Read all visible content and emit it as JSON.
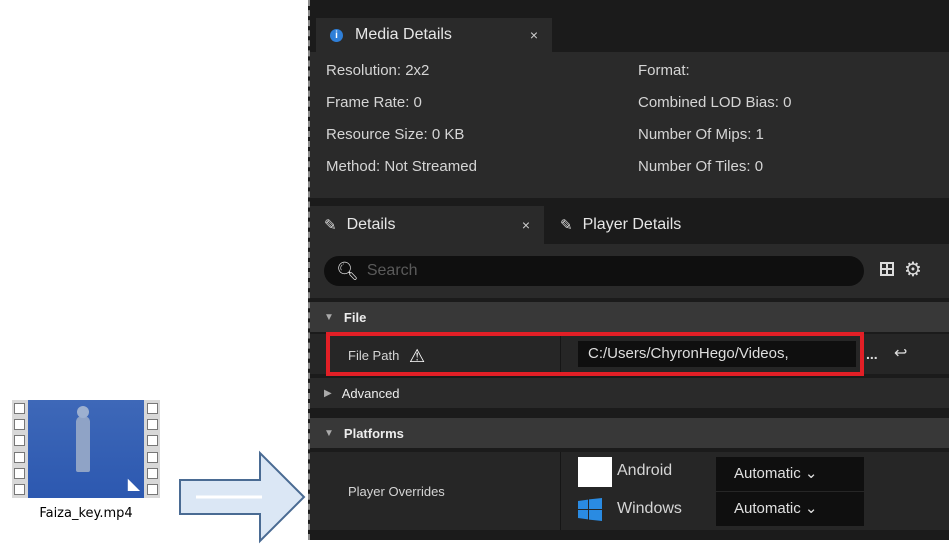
{
  "file_icon": {
    "name": "Faiza_key.mp4"
  },
  "media_details": {
    "tab_label": "Media Details",
    "close_glyph": "×",
    "left": [
      "Resolution: 2x2",
      "Frame Rate: 0",
      "Resource Size: 0 KB",
      "Method: Not Streamed"
    ],
    "right": [
      "Format:",
      "Combined LOD Bias: 0",
      "Number Of Mips: 1",
      "Number Of Tiles: 0"
    ]
  },
  "details": {
    "tabs": [
      {
        "label": "Details",
        "close": "×"
      },
      {
        "label": "Player Details"
      }
    ],
    "search_placeholder": "Search",
    "categories": {
      "file": "File",
      "advanced": "Advanced",
      "platforms": "Platforms"
    },
    "file_path": {
      "label": "File Path",
      "value": "C:/Users/ChyronHego/Videos,",
      "browse": "...",
      "reset_glyph": "↩"
    },
    "player_overrides": {
      "label": "Player Overrides",
      "platforms": [
        {
          "name": "Android",
          "value": "Automatic ⌄"
        },
        {
          "name": "Windows",
          "value": "Automatic ⌄"
        }
      ]
    }
  },
  "colors": {
    "panel_bg": "#1b1b1b",
    "highlight": "#e21f26",
    "arrow_fill": "#dbe7f5"
  },
  "icons": [
    "info-icon",
    "pen-icon",
    "search-icon",
    "grid-icon",
    "gear-icon",
    "warning-icon",
    "reset-icon",
    "windows-icon",
    "video-file-icon",
    "right-arrow-icon"
  ]
}
